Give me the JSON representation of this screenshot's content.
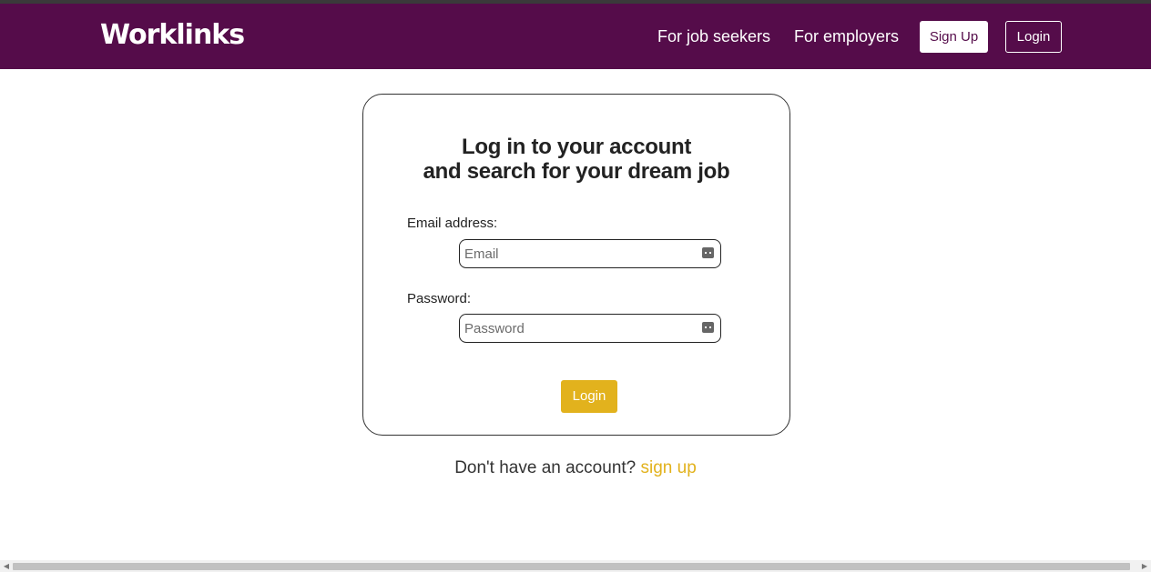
{
  "navbar": {
    "logo": "Worklinks",
    "links": {
      "job_seekers": "For job seekers",
      "employers": "For employers"
    },
    "signup_label": "Sign Up",
    "login_label": "Login",
    "background_color": "#550c4a"
  },
  "login_card": {
    "title_line1": "Log in to your account",
    "title_line2": "and search for your dream job",
    "email": {
      "label": "Email address:",
      "placeholder": "Email",
      "value": ""
    },
    "password": {
      "label": "Password:",
      "placeholder": "Password",
      "value": ""
    },
    "submit_label": "Login",
    "accent_color": "#e2b21d"
  },
  "signup_prompt": {
    "text": "Don't have an account?",
    "link_text": "sign up"
  },
  "icons": {
    "field_autofill": "password-manager-key-icon",
    "scroll_left": "chevron-left-icon",
    "scroll_right": "chevron-right-icon"
  }
}
